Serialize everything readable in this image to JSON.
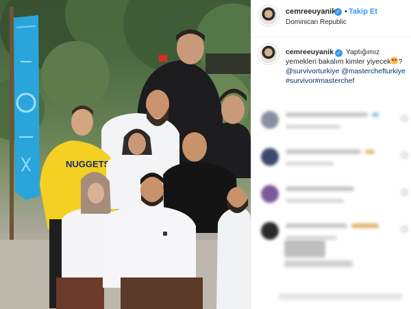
{
  "post": {
    "author": {
      "username": "cemreeuyanik",
      "verified_icon": "verified-badge-icon",
      "follow_label": "Takip Et",
      "location": "Dominican Republic"
    },
    "caption": {
      "username": "cemreeuyanik",
      "text": "Yaptığımız yemekleri bakalım kimler yiyecek",
      "emoji_icon": "smiling-face-with-heart-eyes-icon",
      "mention_1": "@survivorturkiye",
      "mention_2": "@masterchefturkiye",
      "tags": "#survivor#masterchef",
      "question_mark": "?"
    },
    "photo": {
      "banner_color": "#2aa5dc",
      "shirt_text": "NUGGETS"
    },
    "colors": {
      "accent": "#3897f0",
      "link": "#003569"
    }
  }
}
